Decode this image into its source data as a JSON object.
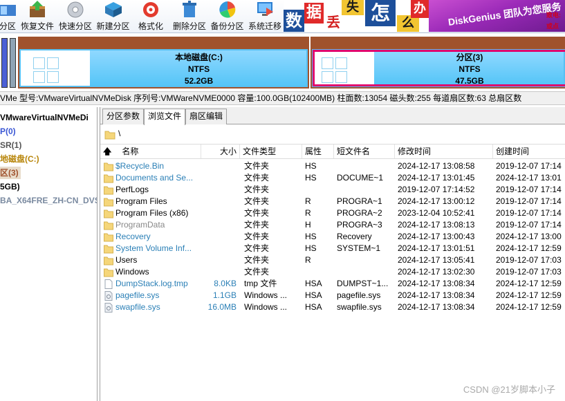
{
  "toolbar": {
    "buttons": [
      {
        "label": "分区",
        "icon": "partition-icon"
      },
      {
        "label": "恢复文件",
        "icon": "recover-files-icon"
      },
      {
        "label": "快速分区",
        "icon": "quick-partition-icon"
      },
      {
        "label": "新建分区",
        "icon": "new-partition-icon"
      },
      {
        "label": "格式化",
        "icon": "format-icon"
      },
      {
        "label": "删除分区",
        "icon": "delete-partition-icon"
      },
      {
        "label": "备份分区",
        "icon": "backup-partition-icon"
      },
      {
        "label": "系统迁移",
        "icon": "system-migration-icon"
      }
    ]
  },
  "banner": {
    "chars": [
      "数",
      "据",
      "丢",
      "失",
      "怎",
      "么",
      "办"
    ],
    "slogan": "DiskGenius 团队为您服务",
    "side_text_1": "致电:",
    "side_text_2": "或点"
  },
  "diskmap": {
    "partitions": [
      {
        "name": "本地磁盘(C:)",
        "fs": "NTFS",
        "size": "52.2GB"
      },
      {
        "name": "分区(3)",
        "fs": "NTFS",
        "size": "47.5GB"
      }
    ]
  },
  "infobar": {
    "text": "VMe  型号:VMwareVirtualNVMeDisk  序列号:VMWareNVME0000  容量:100.0GB(102400MB)  柱面数:13054  磁头数:255  每道扇区数:63  总扇区数"
  },
  "tree": {
    "items": [
      {
        "label": "VMwareVirtualNVMeDi",
        "color": "#000000",
        "selected": false
      },
      {
        "label": "P(0)",
        "color": "#3a56d4",
        "selected": false
      },
      {
        "label": "SR(1)",
        "color": "#555555",
        "selected": false
      },
      {
        "label": "地磁盘(C:)",
        "color": "#b8860b",
        "selected": false
      },
      {
        "label": "区(3)",
        "color": "#a0522d",
        "selected": true
      },
      {
        "label": "5GB)",
        "color": "#000000",
        "selected": false
      },
      {
        "label": "BA_X64FRE_ZH-CN_DVS",
        "color": "#7a8aa0",
        "selected": false
      }
    ]
  },
  "tabs": [
    {
      "label": "分区参数",
      "active": false
    },
    {
      "label": "浏览文件",
      "active": true
    },
    {
      "label": "扇区编辑",
      "active": false
    }
  ],
  "path": "\\",
  "columns": {
    "name": "名称",
    "size": "大小",
    "type": "文件类型",
    "attr": "属性",
    "short": "短文件名",
    "modified": "修改时间",
    "created": "创建时间"
  },
  "files": [
    {
      "name": "$Recycle.Bin",
      "size": "",
      "type": "文件夹",
      "attr": "HS",
      "short": "",
      "modified": "2024-12-17 13:08:58",
      "created": "2019-12-07 17:14",
      "style": "blue",
      "icon": "folder-icon"
    },
    {
      "name": "Documents and Se...",
      "size": "",
      "type": "文件夹",
      "attr": "HS",
      "short": "DOCUME~1",
      "modified": "2024-12-17 13:01:45",
      "created": "2024-12-17 13:01",
      "style": "blue",
      "icon": "folder-icon"
    },
    {
      "name": "PerfLogs",
      "size": "",
      "type": "文件夹",
      "attr": "",
      "short": "",
      "modified": "2019-12-07 17:14:52",
      "created": "2019-12-07 17:14",
      "style": "black",
      "icon": "folder-icon"
    },
    {
      "name": "Program Files",
      "size": "",
      "type": "文件夹",
      "attr": "R",
      "short": "PROGRA~1",
      "modified": "2024-12-17 13:00:12",
      "created": "2019-12-07 17:14",
      "style": "black",
      "icon": "folder-icon"
    },
    {
      "name": "Program Files (x86)",
      "size": "",
      "type": "文件夹",
      "attr": "R",
      "short": "PROGRA~2",
      "modified": "2023-12-04 10:52:41",
      "created": "2019-12-07 17:14",
      "style": "black",
      "icon": "folder-icon"
    },
    {
      "name": "ProgramData",
      "size": "",
      "type": "文件夹",
      "attr": "H",
      "short": "PROGRA~3",
      "modified": "2024-12-17 13:08:13",
      "created": "2019-12-07 17:14",
      "style": "gray",
      "icon": "folder-icon"
    },
    {
      "name": "Recovery",
      "size": "",
      "type": "文件夹",
      "attr": "HS",
      "short": "Recovery",
      "modified": "2024-12-17 13:00:43",
      "created": "2024-12-17 13:00",
      "style": "blue",
      "icon": "folder-icon"
    },
    {
      "name": "System Volume Inf...",
      "size": "",
      "type": "文件夹",
      "attr": "HS",
      "short": "SYSTEM~1",
      "modified": "2024-12-17 13:01:51",
      "created": "2024-12-17 12:59",
      "style": "blue",
      "icon": "folder-icon"
    },
    {
      "name": "Users",
      "size": "",
      "type": "文件夹",
      "attr": "R",
      "short": "",
      "modified": "2024-12-17 13:05:41",
      "created": "2019-12-07 17:03",
      "style": "black",
      "icon": "folder-icon"
    },
    {
      "name": "Windows",
      "size": "",
      "type": "文件夹",
      "attr": "",
      "short": "",
      "modified": "2024-12-17 13:02:30",
      "created": "2019-12-07 17:03",
      "style": "black",
      "icon": "folder-icon"
    },
    {
      "name": "DumpStack.log.tmp",
      "size": "8.0KB",
      "type": "tmp 文件",
      "attr": "HSA",
      "short": "DUMPST~1...",
      "modified": "2024-12-17 13:08:34",
      "created": "2024-12-17 12:59",
      "style": "blue",
      "icon": "file-icon"
    },
    {
      "name": "pagefile.sys",
      "size": "1.1GB",
      "type": "Windows ...",
      "attr": "HSA",
      "short": "pagefile.sys",
      "modified": "2024-12-17 13:08:34",
      "created": "2024-12-17 12:59",
      "style": "blue",
      "icon": "sys-file-icon"
    },
    {
      "name": "swapfile.sys",
      "size": "16.0MB",
      "type": "Windows ...",
      "attr": "HSA",
      "short": "swapfile.sys",
      "modified": "2024-12-17 13:08:34",
      "created": "2024-12-17 12:59",
      "style": "blue",
      "icon": "sys-file-icon"
    }
  ],
  "watermark": "CSDN @21岁脚本小子",
  "colors": {
    "partition_border": "#a0522d",
    "partition_fill": "#57c0f2",
    "selected_outline": "#e0006c",
    "hidden_file_blue": "#2a7fb6"
  }
}
